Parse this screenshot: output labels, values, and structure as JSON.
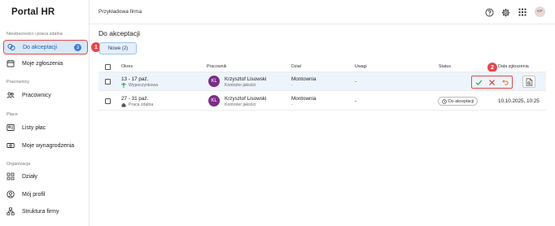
{
  "app": {
    "title": "Portal HR",
    "company": "Przykładowa firma"
  },
  "sidebar": {
    "sections": [
      {
        "label": "Nieobecności i praca zdalna"
      },
      {
        "label": "Pracownicy"
      },
      {
        "label": "Płace"
      },
      {
        "label": "Organizacja"
      }
    ],
    "items": [
      {
        "label": "Do akceptacji",
        "badge": "3",
        "icon": "calendar-check-icon"
      },
      {
        "label": "Moje zgłoszenia",
        "icon": "calendar-icon"
      },
      {
        "label": "Pracownicy",
        "icon": "people-icon"
      },
      {
        "label": "Listy płac",
        "icon": "payroll-icon"
      },
      {
        "label": "Moje wynagrodzenia",
        "icon": "money-icon"
      },
      {
        "label": "Działy",
        "icon": "org-chart-icon"
      },
      {
        "label": "Mój profil",
        "icon": "user-circle-icon"
      },
      {
        "label": "Struktura firmy",
        "icon": "hierarchy-icon"
      }
    ]
  },
  "topbar": {
    "user_initials": "KP"
  },
  "page": {
    "title": "Do akceptacji",
    "tab_label": "Nowe (2)"
  },
  "callouts": [
    "1",
    "2"
  ],
  "table": {
    "headers": [
      "Okres",
      "Pracownik",
      "Dział",
      "Uwagi",
      "Status",
      "Data zgłoszenia"
    ],
    "rows": [
      {
        "period": "13 - 17 paź.",
        "type": "Wypoczynkowa",
        "initials": "KL",
        "name": "Krzysztof Lisowski",
        "role": "Kontroler jakości",
        "dept": "Montownia",
        "dept_sub": "-",
        "notes": "-",
        "status": "",
        "date": ""
      },
      {
        "period": "27 - 31 paź.",
        "type": "Praca zdalna",
        "initials": "KL",
        "name": "Krzysztof Lisowski",
        "role": "Kontroler jakości",
        "dept": "Montownia",
        "dept_sub": "-",
        "notes": "-",
        "status": "Do akceptacji",
        "date": "10.10.2025, 10:25"
      }
    ]
  },
  "colors": {
    "accent": "#3f7fd8",
    "callout": "#e04a4a",
    "avatar": "#7a2e86",
    "approve": "#3a9d4a",
    "reject": "#d8372f",
    "undo": "#e67e22"
  }
}
